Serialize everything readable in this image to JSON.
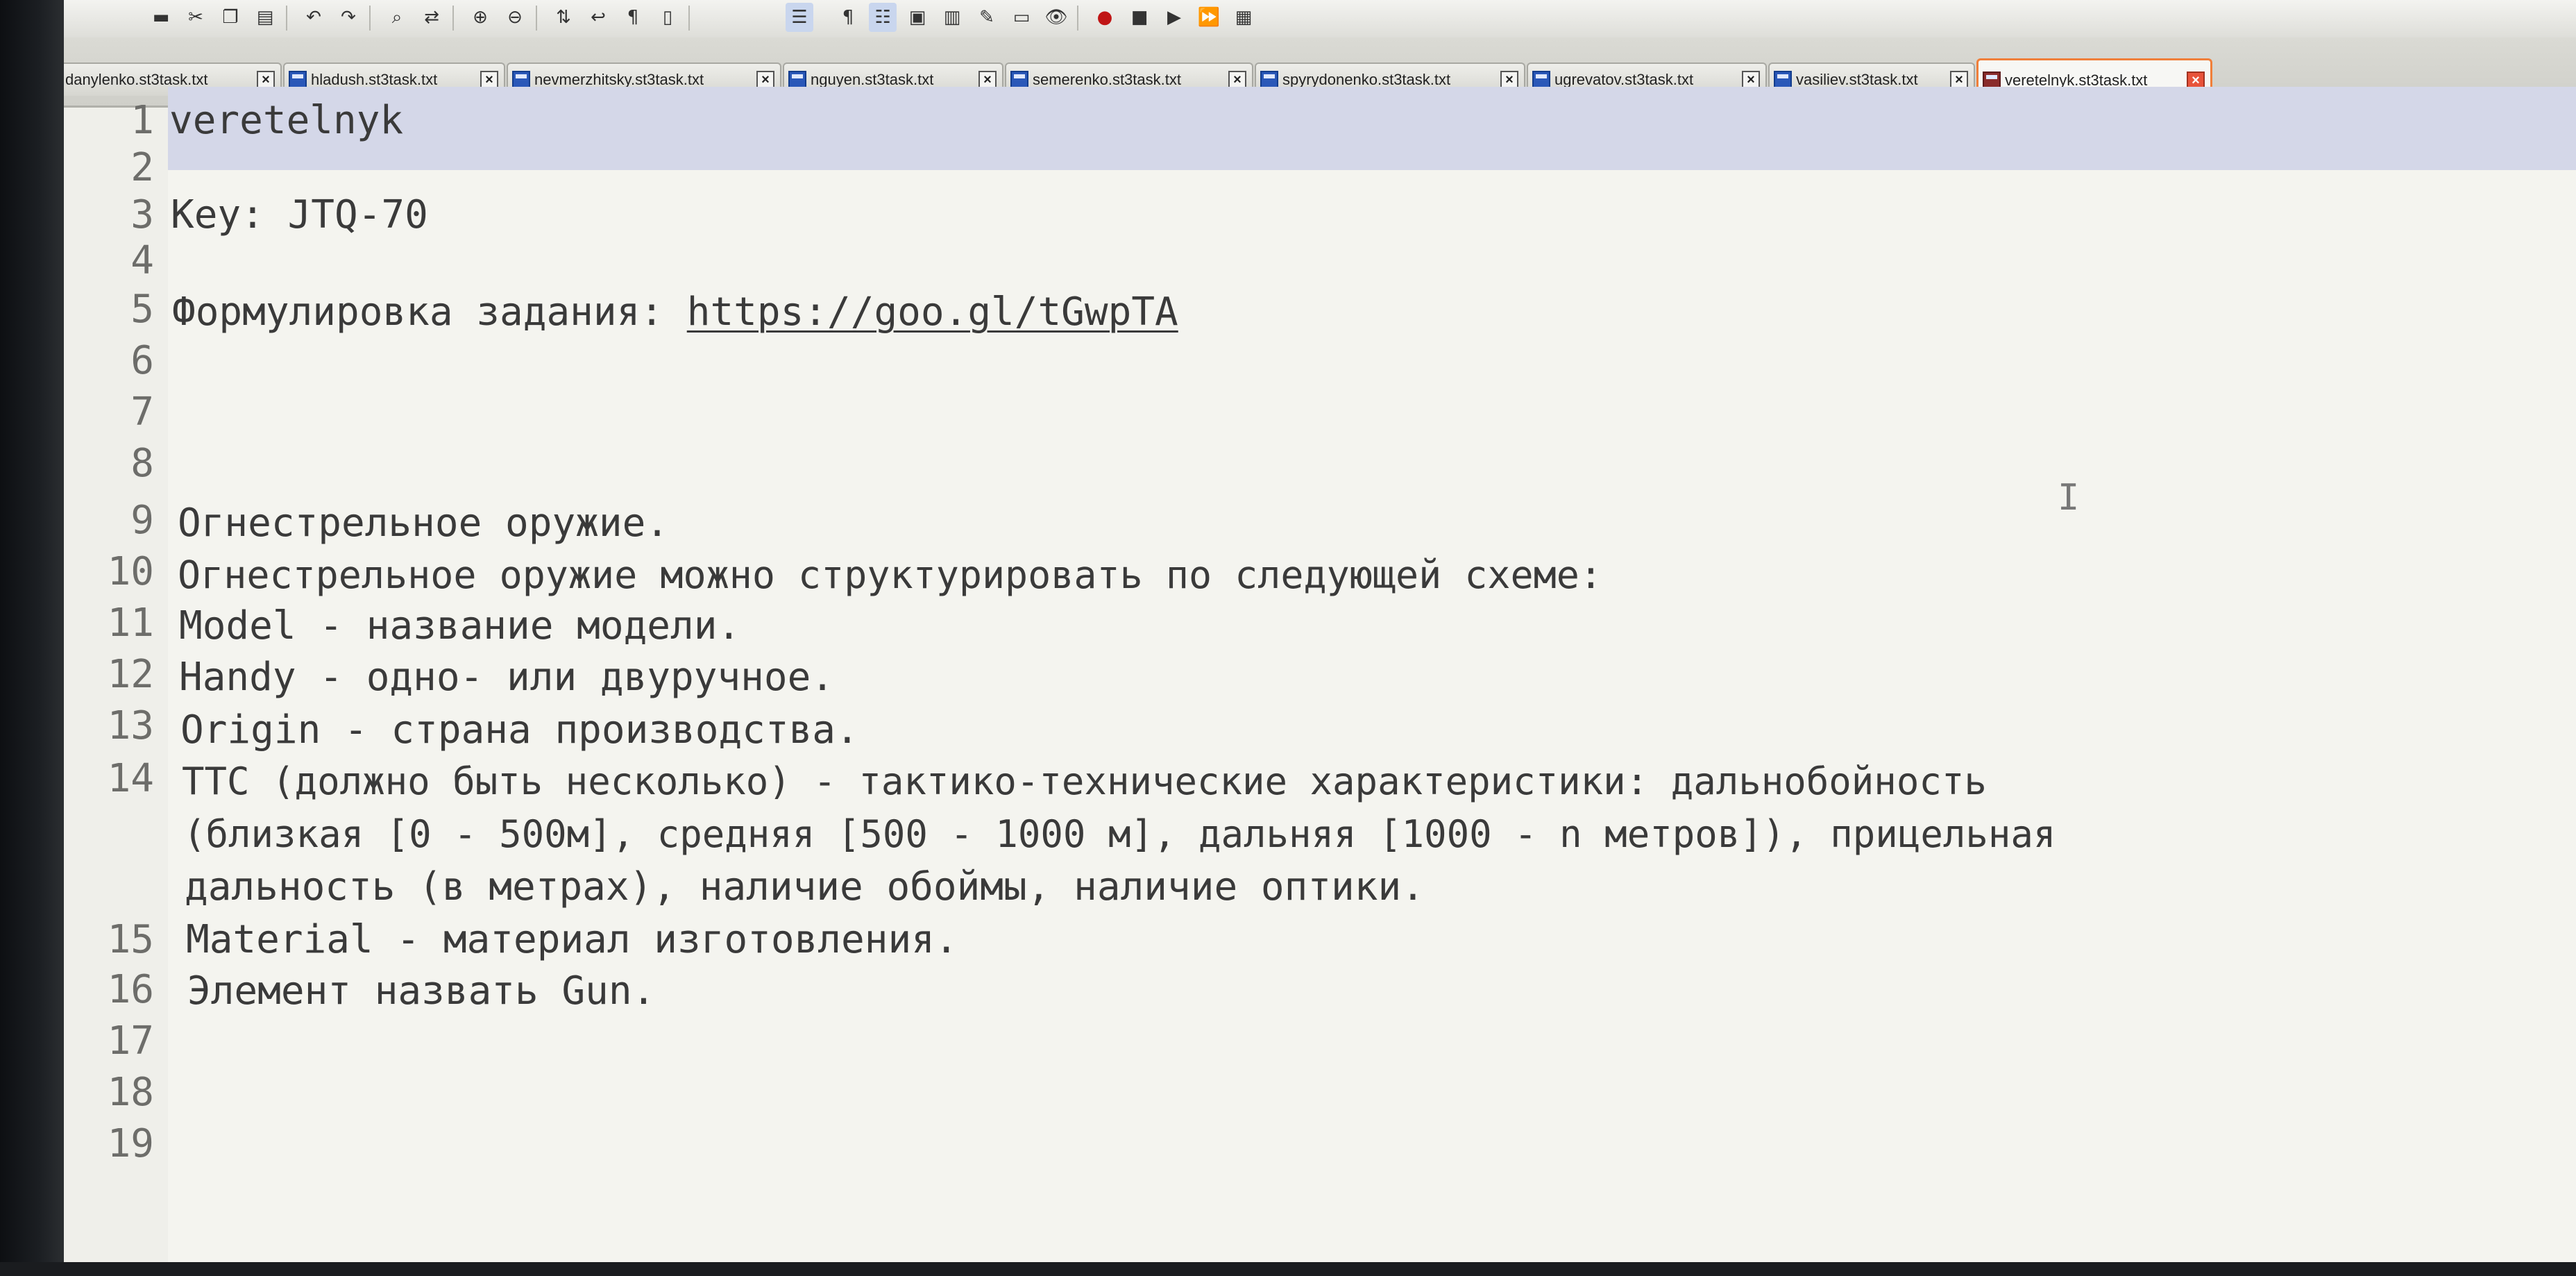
{
  "tabs": [
    {
      "label": "danylenko.st3task.txt",
      "active": false
    },
    {
      "label": "hladush.st3task.txt",
      "active": false
    },
    {
      "label": "nevmerzhitsky.st3task.txt",
      "active": false
    },
    {
      "label": "nguyen.st3task.txt",
      "active": false
    },
    {
      "label": "semerenko.st3task.txt",
      "active": false
    },
    {
      "label": "spyrydonenko.st3task.txt",
      "active": false
    },
    {
      "label": "ugrevatov.st3task.txt",
      "active": false
    },
    {
      "label": "vasiliev.st3task.txt",
      "active": false
    },
    {
      "label": "veretelnyk.st3task.txt",
      "active": true
    }
  ],
  "toolbar": {
    "icons": [
      "save-icon",
      "cut-icon",
      "copy-icon",
      "paste-icon",
      "undo-icon",
      "redo-icon",
      "find-icon",
      "replace-icon",
      "zoom-in-icon",
      "zoom-out-icon",
      "sync-scroll-icon",
      "word-wrap-icon",
      "show-all-chars-icon",
      "indent-guide-icon",
      "doc-map-icon",
      "function-list-icon",
      "folder-workspace-icon",
      "monitor-icon",
      "record-macro-icon",
      "stop-macro-icon",
      "play-macro-icon",
      "run-macro-multiple-icon",
      "save-macro-icon"
    ]
  },
  "editor": {
    "lines": [
      {
        "num": "1",
        "text": "veretelnyk"
      },
      {
        "num": "2",
        "text": ""
      },
      {
        "num": "3",
        "text": "Key: JTQ-70"
      },
      {
        "num": "4",
        "text": ""
      },
      {
        "num": "5",
        "prefix": "Формулировка задания: ",
        "url": "https://goo.gl/tGwpTA"
      },
      {
        "num": "6",
        "text": ""
      },
      {
        "num": "7",
        "text": ""
      },
      {
        "num": "8",
        "text": ""
      },
      {
        "num": "9",
        "text": "Огнестрельное оружие."
      },
      {
        "num": "10",
        "text": "Огнестрельное оружие можно структурировать по следующей схеме:"
      },
      {
        "num": "11",
        "text": "Model - название модели."
      },
      {
        "num": "12",
        "text": "Handy - одно- или двуручное."
      },
      {
        "num": "13",
        "text": "Origin - страна производства."
      },
      {
        "num": "14",
        "text": "TTC (должно быть несколько) - тактико-технические характеристики: дальнобойность",
        "cont1": "(близкая [0 - 500м], средняя [500 - 1000 м], дальняя [1000 - n метров]), прицельная",
        "cont2": "дальность (в метрах), наличие обоймы, наличие оптики."
      },
      {
        "num": "15",
        "text": "Material - материал изготовления."
      },
      {
        "num": "16",
        "text": "Элемент назвать Gun."
      },
      {
        "num": "17",
        "text": ""
      },
      {
        "num": "18",
        "text": ""
      },
      {
        "num": "19",
        "text": ""
      }
    ]
  }
}
